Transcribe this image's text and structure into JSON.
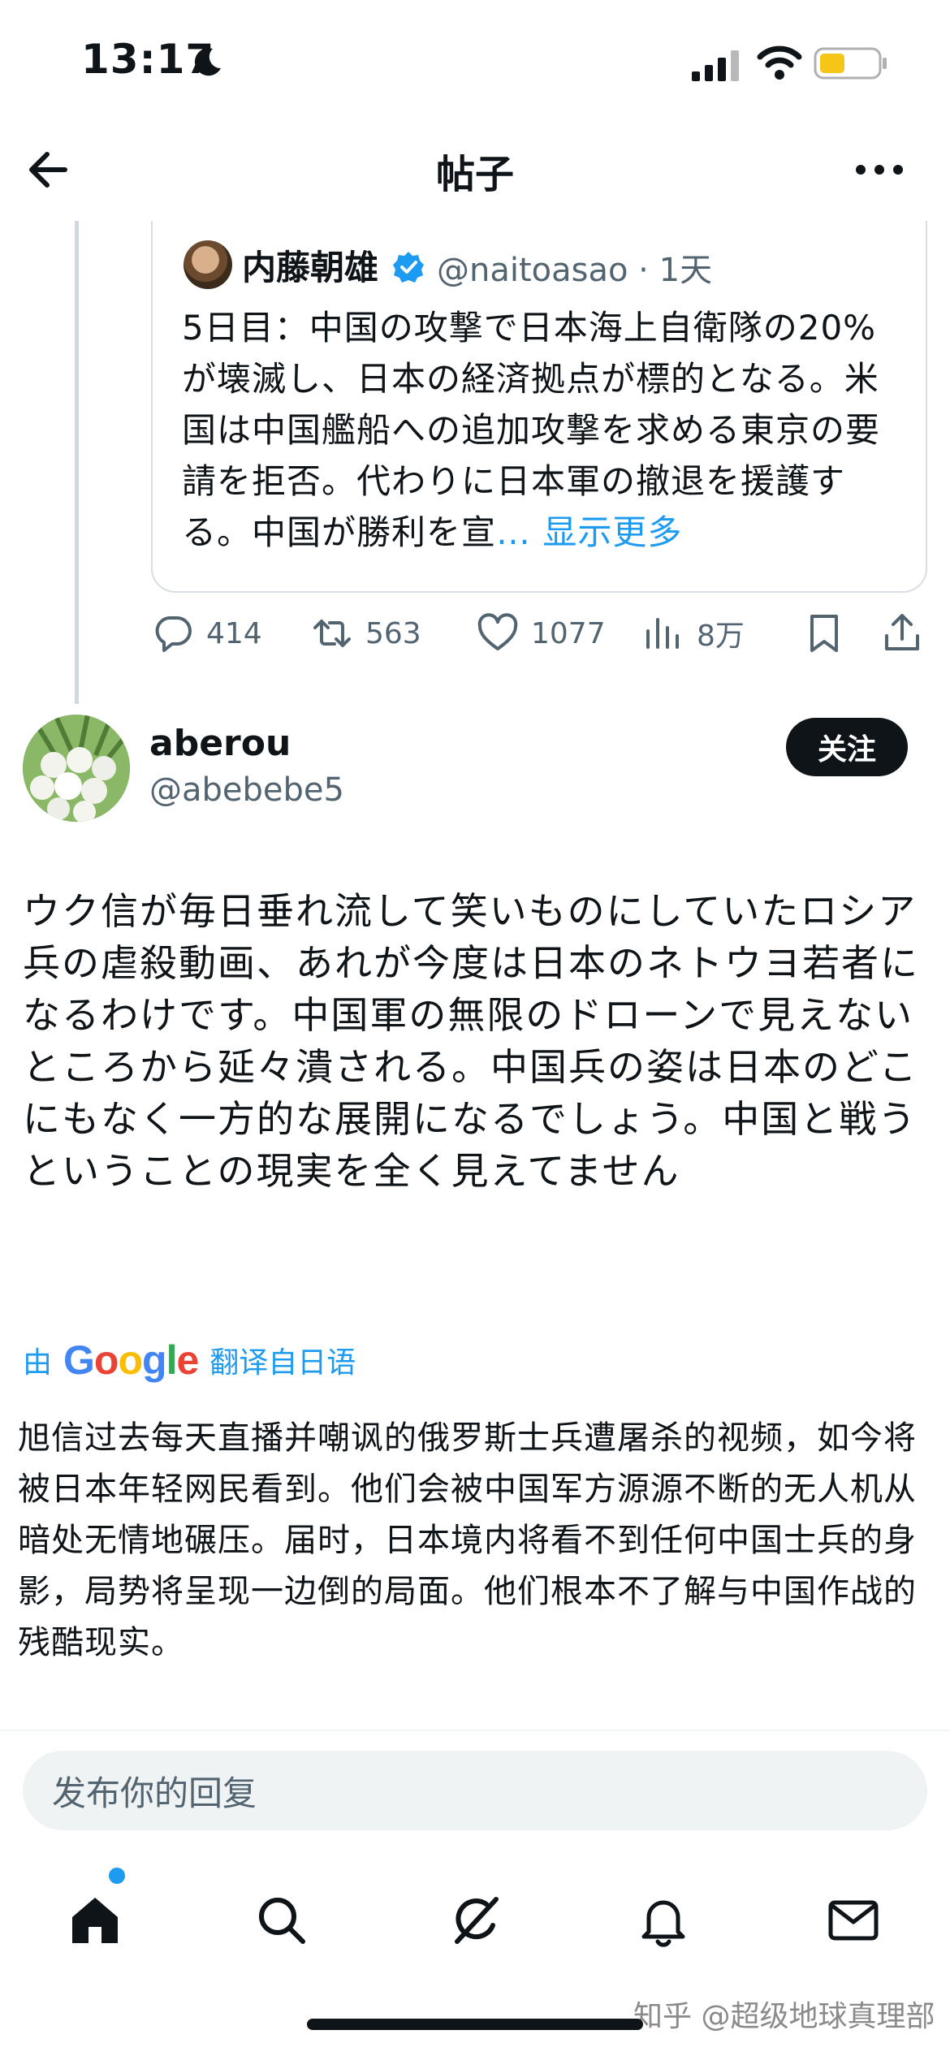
{
  "status_bar": {
    "time": "13:17"
  },
  "header": {
    "title": "帖子"
  },
  "quoted_tweet": {
    "author_name": "内藤朝雄",
    "handle_time": "@naitoasao · 1天",
    "text": "5日目：中国の攻撃で日本海上自衛隊の20%が壊滅し、日本の経済拠点が標的となる。米国は中国艦船への追加攻撃を求める東京の要請を拒否。代わりに日本軍の撤退を援護する。中国が勝利を宣",
    "show_more": "… 显示更多",
    "stats": {
      "replies": "414",
      "retweets": "563",
      "likes": "1077",
      "views": "8万"
    }
  },
  "author": {
    "name": "aberou",
    "handle": "@abebebe5",
    "follow_label": "关注"
  },
  "tweet": {
    "text": "ウク信が毎日垂れ流して笑いものにしていたロシア兵の虐殺動画、あれが今度は日本のネトウヨ若者になるわけです。中国軍の無限のドローンで見えないところから延々潰される。中国兵の姿は日本のどこにもなく一方的な展開になるでしょう。中国と戦うということの現実を全く見えてません",
    "translate_prefix": "由",
    "translate_suffix": "翻译自日语",
    "translation": "旭信过去每天直播并嘲讽的俄罗斯士兵遭屠杀的视频，如今将被日本年轻网民看到。他们会被中国军方源源不断的无人机从暗处无情地碾压。届时，日本境内将看不到任何中国士兵的身影，局势将呈现一边倒的局面。他们根本不了解与中国作战的残酷现实。"
  },
  "reply": {
    "placeholder": "发布你的回复"
  },
  "watermark": "知乎 @超级地球真理部",
  "icons": [
    "moon-icon",
    "signal-icon",
    "wifi-icon",
    "battery-icon",
    "back-icon",
    "more-icon",
    "verified-icon",
    "reply-icon",
    "retweet-icon",
    "like-icon",
    "views-icon",
    "bookmark-icon",
    "share-icon",
    "home-icon",
    "search-icon",
    "grok-icon",
    "notifications-icon",
    "messages-icon"
  ],
  "colors": {
    "accent": "#1d9bf0",
    "text": "#0f1419",
    "secondary": "#536471",
    "battery": "#f5c518"
  }
}
